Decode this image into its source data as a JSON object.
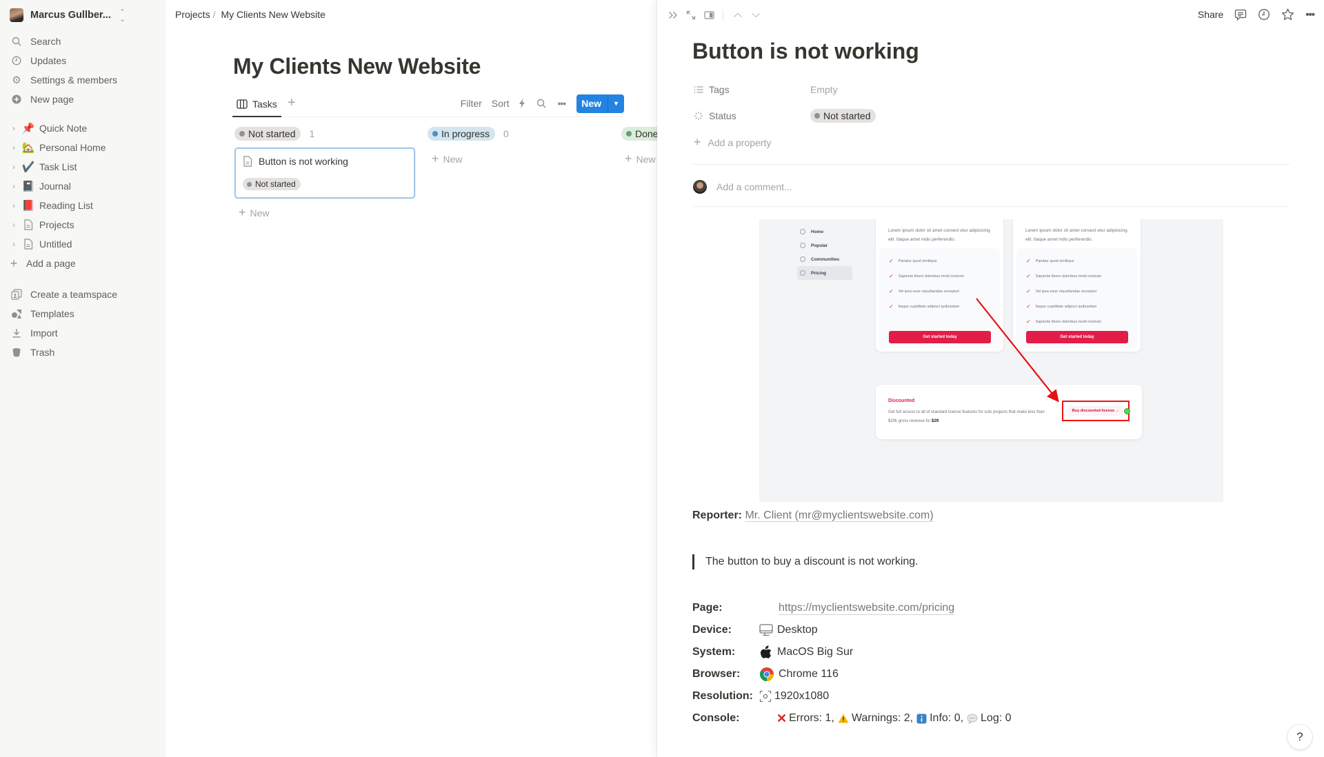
{
  "sidebar": {
    "workspace_name": "Marcus Gullber...",
    "top_items": [
      {
        "label": "Search",
        "icon": "search-icon"
      },
      {
        "label": "Updates",
        "icon": "clock-icon"
      },
      {
        "label": "Settings & members",
        "icon": "gear-icon"
      },
      {
        "label": "New page",
        "icon": "plus-circle-icon"
      }
    ],
    "pages": [
      {
        "label": "Quick Note",
        "emoji": "📌"
      },
      {
        "label": "Personal Home",
        "emoji": "🏡"
      },
      {
        "label": "Task List",
        "emoji": "✔️"
      },
      {
        "label": "Journal",
        "emoji": "📓"
      },
      {
        "label": "Reading List",
        "emoji": "📕"
      },
      {
        "label": "Projects",
        "emoji": "page"
      },
      {
        "label": "Untitled",
        "emoji": "page"
      }
    ],
    "add_page": "Add a page",
    "bottom_items": [
      {
        "label": "Create a teamspace",
        "icon": "teamspace-icon"
      },
      {
        "label": "Templates",
        "icon": "templates-icon"
      },
      {
        "label": "Import",
        "icon": "import-icon"
      },
      {
        "label": "Trash",
        "icon": "trash-icon"
      }
    ]
  },
  "breadcrumb": {
    "parent": "Projects",
    "separator": "/",
    "current": "My Clients New Website"
  },
  "database": {
    "title": "My Clients New Website",
    "view_tab": "Tasks",
    "actions": {
      "filter": "Filter",
      "sort": "Sort",
      "new": "New"
    },
    "columns": [
      {
        "label": "Not started",
        "count": "1",
        "color": "#91918e",
        "bg": "#e3e2e0",
        "new_label": "New"
      },
      {
        "label": "In progress",
        "count": "0",
        "color": "#4f8fc1",
        "bg": "#d3e5ef",
        "new_label": "New"
      },
      {
        "label": "Done",
        "count": "",
        "color": "#6c9b7d",
        "bg": "#dbeddb",
        "new_label": "New"
      }
    ],
    "cards": [
      {
        "title": "Button is not working",
        "status": "Not started"
      }
    ]
  },
  "peek": {
    "share": "Share",
    "title": "Button is not working",
    "properties": [
      {
        "name": "Tags",
        "value": "Empty",
        "icon": "list-icon"
      },
      {
        "name": "Status",
        "value": "Not started",
        "icon": "status-icon"
      }
    ],
    "add_property": "Add a property",
    "comment_placeholder": "Add a comment...",
    "screenshot": {
      "nav": [
        "Home",
        "Popular",
        "Communities",
        "Pricing"
      ],
      "nav_active": "Pricing",
      "card_lorem": "Lorem ipsum dolor sit amet consect etur adipisicing elit. Itaque amet indis perferendis.",
      "card1_features": [
        "Pariatur quod similique",
        "Sapiente libero doloribus modi nostrum",
        "Vel ipsa esse repudiandae excepturi",
        "Itaque cupiditate adipisci quibusdam"
      ],
      "card2_features": [
        "Pariatur quod similique",
        "Sapiente libero doloribus modi nostrum",
        "Vel ipsa esse repudiandae excepturi",
        "Itaque cupiditate adipisci quibusdam",
        "Sapiente libero doloribus modi nostrum"
      ],
      "cta": "Get started today",
      "discount_title": "Discounted",
      "discount_desc": "Get full access to all of standard license features for solo projects that make less than $20k gross revenue for",
      "discount_price": "$29",
      "discount_button": "Buy discounted license →"
    },
    "reporter_label": "Reporter:",
    "reporter_value": "Mr. Client (mr@myclientswebsite.com)",
    "quote": "The button to buy a discount is not working.",
    "info": {
      "page_label": "Page:",
      "page_value": "https://myclientswebsite.com/pricing",
      "device_label": "Device:",
      "device_value": "Desktop",
      "system_label": "System:",
      "system_value": "MacOS Big Sur",
      "browser_label": "Browser:",
      "browser_value": "Chrome 116",
      "resolution_label": "Resolution:",
      "resolution_value": "1920x1080",
      "console_label": "Console:",
      "console_errors": "Errors: 1,",
      "console_warnings": "Warnings: 2,",
      "console_info": "Info: 0,",
      "console_log": "Log: 0"
    }
  },
  "help": "?"
}
